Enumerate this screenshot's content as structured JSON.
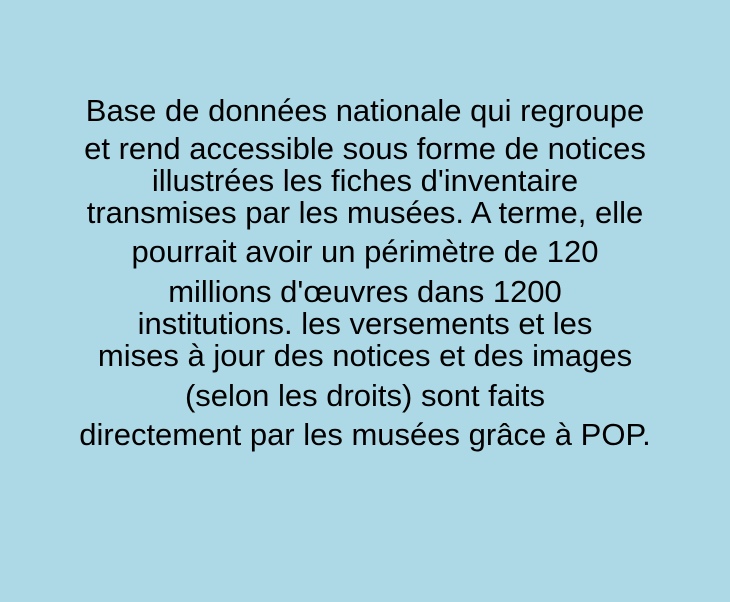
{
  "background_color": "#add8e6",
  "text_color": "#000000",
  "paragraph": {
    "lines": [
      "Base de données nationale qui regroupe",
      "et rend accessible sous forme de notices",
      "illustrées les fiches d'inventaire",
      "transmises par les musées. A terme, elle",
      "pourrait avoir un périmètre de 120",
      "millions d'œuvres dans 1200",
      "institutions. les versements et les",
      "mises à jour des notices et des images",
      "(selon les droits) sont faits",
      "directement par les musées grâce à POP."
    ]
  }
}
